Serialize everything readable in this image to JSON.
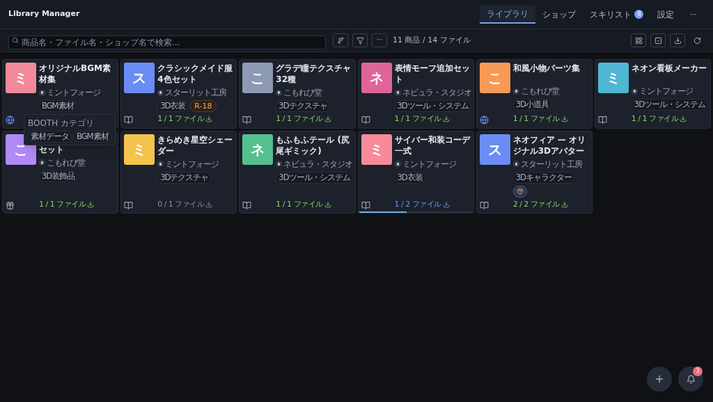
{
  "app_title": "Library Manager",
  "tabs": [
    {
      "label": "ライブラリ",
      "selected": true
    },
    {
      "label": "ショップ",
      "selected": false
    },
    {
      "label": "スキリスト",
      "selected": false,
      "badge": "8"
    },
    {
      "label": "設定",
      "selected": false
    }
  ],
  "more_menu": "···",
  "search": {
    "placeholder": "商品名・ファイル名・ショップ名で検索..."
  },
  "toolbar_more": "···",
  "summary": "11 商品 / 14 ファイル",
  "products": [
    {
      "title": "オリジナルBGM素材集",
      "thumb": "ミ",
      "color": "#f2899a",
      "shop": "ミントフォージ",
      "kind": "globe",
      "tags": [
        {
          "kind": "category",
          "label": "BGM素材"
        }
      ]
    },
    {
      "title": "クラシックメイド服 4色セット",
      "thumb": "ス",
      "color": "#6b8cf5",
      "shop": "スターリット工房",
      "kind": "book",
      "tags": [
        {
          "kind": "category",
          "label": "3D衣装"
        },
        {
          "kind": "rating",
          "label": "R-18"
        }
      ],
      "files": {
        "text": "1 / 1 ファイル",
        "color": "#8fcf6a"
      }
    },
    {
      "title": "グラデ瞳テクスチャ 32種",
      "thumb": "こ",
      "color": "#8d9ab3",
      "shop": "こもれび堂",
      "kind": "book",
      "tags": [
        {
          "kind": "category",
          "label": "3Dテクスチャ"
        }
      ],
      "files": {
        "text": "1 / 1 ファイル",
        "color": "#8fcf6a"
      }
    },
    {
      "title": "表情モーフ追加セット",
      "thumb": "ネ",
      "color": "#de6499",
      "shop": "ネビュラ・スタジオ",
      "kind": "book",
      "tags": [
        {
          "kind": "category",
          "label": "3Dツール・システム"
        }
      ],
      "files": {
        "text": "1 / 1 ファイル",
        "color": "#8fcf6a"
      }
    },
    {
      "title": "和風小物パーツ集",
      "thumb": "こ",
      "color": "#f89a55",
      "shop": "こもれび堂",
      "kind": "globe",
      "tags": [
        {
          "kind": "category",
          "label": "3D小道具"
        }
      ],
      "files": {
        "text": "1 / 1 ファイル",
        "color": "#8fcf6a"
      }
    },
    {
      "title": "ネオン看板メーカー",
      "thumb": "ミ",
      "color": "#4fb6d3",
      "shop": "ミントフォージ",
      "kind": "book",
      "tags": [
        {
          "kind": "category",
          "label": "3Dツール・システム"
        }
      ],
      "files": {
        "text": "1 / 1 ファイル",
        "color": "#8fcf6a"
      }
    },
    {
      "title": "セット",
      "thumb": "こ",
      "color": "#b18af5",
      "shop": "こもれび堂",
      "kind": "gift",
      "tags": [
        {
          "kind": "category",
          "label": "3D装飾品"
        }
      ],
      "files": {
        "text": "1 / 1 ファイル",
        "color": "#8fcf6a"
      },
      "covered": true
    },
    {
      "title": "きらめき星空シェーダー",
      "thumb": "ミ",
      "color": "#f5c34c",
      "shop": "ミントフォージ",
      "kind": "book",
      "tags": [
        {
          "kind": "category",
          "label": "3Dテクスチャ"
        }
      ],
      "files": {
        "text": "0 / 1 ファイル",
        "color": "#8a93a5"
      }
    },
    {
      "title": "もふもふテール (尻尾ギミック)",
      "thumb": "ネ",
      "color": "#55c08f",
      "shop": "ネビュラ・スタジオ",
      "kind": "book",
      "tags": [
        {
          "kind": "category",
          "label": "3Dツール・システム"
        }
      ],
      "files": {
        "text": "1 / 1 ファイル",
        "color": "#8fcf6a"
      }
    },
    {
      "title": "サイバー和装コーデ一式",
      "thumb": "ミ",
      "color": "#f78a9a",
      "shop": "ミントフォージ",
      "kind": "book",
      "tags": [
        {
          "kind": "category",
          "label": "3D衣装"
        }
      ],
      "files": {
        "text": "1 / 2 ファイル",
        "color": "#6b9ef5"
      },
      "level": 0.42
    },
    {
      "title": "ネオフィア — オリジナル3Dアバター",
      "thumb": "ス",
      "color": "#6b8cf5",
      "shop": "スターリット工房",
      "kind": "book",
      "tags": [
        {
          "kind": "category",
          "label": "3Dキャラクター"
        },
        {
          "kind": "box"
        }
      ],
      "files": {
        "text": "2 / 2 ファイル",
        "color": "#8fcf6a"
      }
    }
  ],
  "tooltip": {
    "title": "BOOTH カテゴリ",
    "tags": [
      "素材データ",
      "BGM素材"
    ]
  },
  "notifications": {
    "count": "3"
  }
}
